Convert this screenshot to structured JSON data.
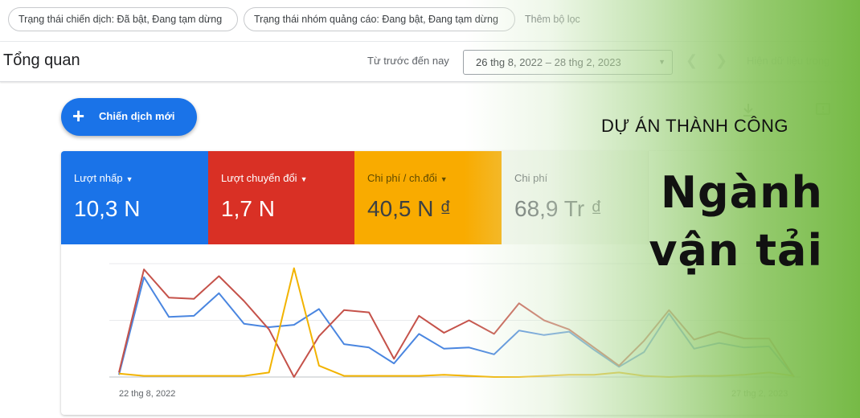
{
  "filters": {
    "campaign_status": "Trạng thái chiến dịch: Đã bật, Đang tạm dừng",
    "ad_group_status": "Trạng thái nhóm quảng cáo: Đang bật, Đang tạm dừng",
    "add_filter": "Thêm bộ lọc"
  },
  "header": {
    "title": "Tổng quan",
    "range_label": "Từ trước đến nay",
    "date_range": "26 thg 8, 2022 – 28 thg 2, 2023",
    "show_data": "Hiện dữ liệu trong"
  },
  "fab": {
    "plus": "+",
    "label": "Chiến dịch mới"
  },
  "icons": {
    "download": "download-icon",
    "feedback": "feedback-icon",
    "more": "more-vert-icon",
    "prev": "chevron-left-icon",
    "next": "chevron-right-icon",
    "dropdown": "caret-down-icon"
  },
  "metrics": [
    {
      "label": "Lượt nhấp",
      "value": "10,3 N",
      "color": "#1a73e8"
    },
    {
      "label": "Lượt chuyển đổi",
      "value": "1,7 N",
      "color": "#d93025"
    },
    {
      "label": "Chi phí / ch.đổi",
      "value": "40,5 N ₫",
      "color": "#f9ab00"
    },
    {
      "label": "Chi phí",
      "value": "68,9 Tr ₫",
      "color": "#f4f7f1"
    }
  ],
  "chart_data": {
    "type": "line",
    "x": [
      "22 thg 8, 2022",
      "27 thg 2, 2023"
    ],
    "series": [
      {
        "name": "Lượt nhấp",
        "color": "#4a86e0",
        "values": [
          0.02,
          0.88,
          0.53,
          0.54,
          0.74,
          0.47,
          0.44,
          0.46,
          0.6,
          0.29,
          0.26,
          0.12,
          0.38,
          0.25,
          0.26,
          0.2,
          0.41,
          0.37,
          0.4,
          0.24,
          0.09,
          0.22,
          0.56,
          0.25,
          0.3,
          0.26,
          0.27,
          0.0
        ]
      },
      {
        "name": "Lượt chuyển đổi",
        "color": "#c5524a",
        "values": [
          0.04,
          0.95,
          0.7,
          0.69,
          0.89,
          0.67,
          0.42,
          0.0,
          0.36,
          0.59,
          0.57,
          0.16,
          0.54,
          0.39,
          0.5,
          0.38,
          0.65,
          0.5,
          0.42,
          0.26,
          0.1,
          0.32,
          0.59,
          0.33,
          0.4,
          0.34,
          0.34,
          0.0
        ]
      },
      {
        "name": "Chi phí / ch.đổi",
        "color": "#f2b300",
        "values": [
          0.03,
          0.01,
          0.01,
          0.01,
          0.01,
          0.01,
          0.04,
          0.96,
          0.1,
          0.01,
          0.01,
          0.01,
          0.01,
          0.02,
          0.01,
          0.0,
          0.0,
          0.01,
          0.02,
          0.02,
          0.04,
          0.01,
          0.0,
          0.01,
          0.01,
          0.02,
          0.04,
          0.01
        ]
      }
    ],
    "grid": true
  },
  "promo": {
    "subtitle": "DỰ ÁN THÀNH CÔNG",
    "title": "Ngành vận tải"
  }
}
